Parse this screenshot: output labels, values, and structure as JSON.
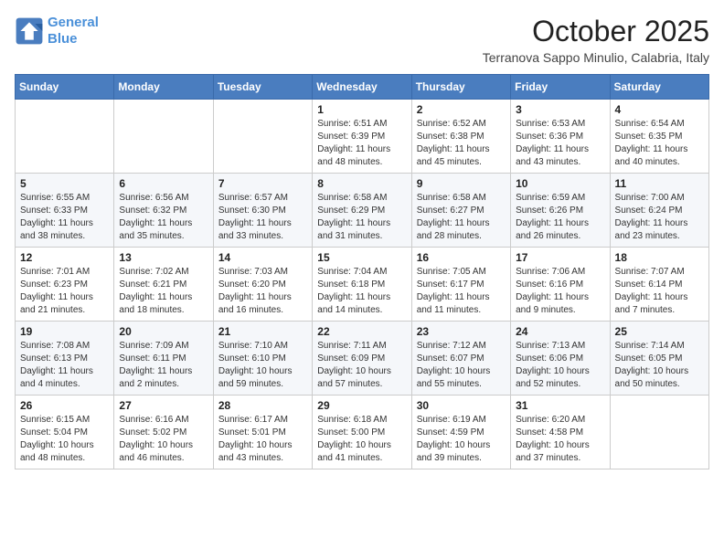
{
  "header": {
    "logo_line1": "General",
    "logo_line2": "Blue",
    "month": "October 2025",
    "location": "Terranova Sappo Minulio, Calabria, Italy"
  },
  "weekdays": [
    "Sunday",
    "Monday",
    "Tuesday",
    "Wednesday",
    "Thursday",
    "Friday",
    "Saturday"
  ],
  "weeks": [
    [
      {
        "day": "",
        "sunrise": "",
        "sunset": "",
        "daylight": ""
      },
      {
        "day": "",
        "sunrise": "",
        "sunset": "",
        "daylight": ""
      },
      {
        "day": "",
        "sunrise": "",
        "sunset": "",
        "daylight": ""
      },
      {
        "day": "1",
        "sunrise": "Sunrise: 6:51 AM",
        "sunset": "Sunset: 6:39 PM",
        "daylight": "Daylight: 11 hours and 48 minutes."
      },
      {
        "day": "2",
        "sunrise": "Sunrise: 6:52 AM",
        "sunset": "Sunset: 6:38 PM",
        "daylight": "Daylight: 11 hours and 45 minutes."
      },
      {
        "day": "3",
        "sunrise": "Sunrise: 6:53 AM",
        "sunset": "Sunset: 6:36 PM",
        "daylight": "Daylight: 11 hours and 43 minutes."
      },
      {
        "day": "4",
        "sunrise": "Sunrise: 6:54 AM",
        "sunset": "Sunset: 6:35 PM",
        "daylight": "Daylight: 11 hours and 40 minutes."
      }
    ],
    [
      {
        "day": "5",
        "sunrise": "Sunrise: 6:55 AM",
        "sunset": "Sunset: 6:33 PM",
        "daylight": "Daylight: 11 hours and 38 minutes."
      },
      {
        "day": "6",
        "sunrise": "Sunrise: 6:56 AM",
        "sunset": "Sunset: 6:32 PM",
        "daylight": "Daylight: 11 hours and 35 minutes."
      },
      {
        "day": "7",
        "sunrise": "Sunrise: 6:57 AM",
        "sunset": "Sunset: 6:30 PM",
        "daylight": "Daylight: 11 hours and 33 minutes."
      },
      {
        "day": "8",
        "sunrise": "Sunrise: 6:58 AM",
        "sunset": "Sunset: 6:29 PM",
        "daylight": "Daylight: 11 hours and 31 minutes."
      },
      {
        "day": "9",
        "sunrise": "Sunrise: 6:58 AM",
        "sunset": "Sunset: 6:27 PM",
        "daylight": "Daylight: 11 hours and 28 minutes."
      },
      {
        "day": "10",
        "sunrise": "Sunrise: 6:59 AM",
        "sunset": "Sunset: 6:26 PM",
        "daylight": "Daylight: 11 hours and 26 minutes."
      },
      {
        "day": "11",
        "sunrise": "Sunrise: 7:00 AM",
        "sunset": "Sunset: 6:24 PM",
        "daylight": "Daylight: 11 hours and 23 minutes."
      }
    ],
    [
      {
        "day": "12",
        "sunrise": "Sunrise: 7:01 AM",
        "sunset": "Sunset: 6:23 PM",
        "daylight": "Daylight: 11 hours and 21 minutes."
      },
      {
        "day": "13",
        "sunrise": "Sunrise: 7:02 AM",
        "sunset": "Sunset: 6:21 PM",
        "daylight": "Daylight: 11 hours and 18 minutes."
      },
      {
        "day": "14",
        "sunrise": "Sunrise: 7:03 AM",
        "sunset": "Sunset: 6:20 PM",
        "daylight": "Daylight: 11 hours and 16 minutes."
      },
      {
        "day": "15",
        "sunrise": "Sunrise: 7:04 AM",
        "sunset": "Sunset: 6:18 PM",
        "daylight": "Daylight: 11 hours and 14 minutes."
      },
      {
        "day": "16",
        "sunrise": "Sunrise: 7:05 AM",
        "sunset": "Sunset: 6:17 PM",
        "daylight": "Daylight: 11 hours and 11 minutes."
      },
      {
        "day": "17",
        "sunrise": "Sunrise: 7:06 AM",
        "sunset": "Sunset: 6:16 PM",
        "daylight": "Daylight: 11 hours and 9 minutes."
      },
      {
        "day": "18",
        "sunrise": "Sunrise: 7:07 AM",
        "sunset": "Sunset: 6:14 PM",
        "daylight": "Daylight: 11 hours and 7 minutes."
      }
    ],
    [
      {
        "day": "19",
        "sunrise": "Sunrise: 7:08 AM",
        "sunset": "Sunset: 6:13 PM",
        "daylight": "Daylight: 11 hours and 4 minutes."
      },
      {
        "day": "20",
        "sunrise": "Sunrise: 7:09 AM",
        "sunset": "Sunset: 6:11 PM",
        "daylight": "Daylight: 11 hours and 2 minutes."
      },
      {
        "day": "21",
        "sunrise": "Sunrise: 7:10 AM",
        "sunset": "Sunset: 6:10 PM",
        "daylight": "Daylight: 10 hours and 59 minutes."
      },
      {
        "day": "22",
        "sunrise": "Sunrise: 7:11 AM",
        "sunset": "Sunset: 6:09 PM",
        "daylight": "Daylight: 10 hours and 57 minutes."
      },
      {
        "day": "23",
        "sunrise": "Sunrise: 7:12 AM",
        "sunset": "Sunset: 6:07 PM",
        "daylight": "Daylight: 10 hours and 55 minutes."
      },
      {
        "day": "24",
        "sunrise": "Sunrise: 7:13 AM",
        "sunset": "Sunset: 6:06 PM",
        "daylight": "Daylight: 10 hours and 52 minutes."
      },
      {
        "day": "25",
        "sunrise": "Sunrise: 7:14 AM",
        "sunset": "Sunset: 6:05 PM",
        "daylight": "Daylight: 10 hours and 50 minutes."
      }
    ],
    [
      {
        "day": "26",
        "sunrise": "Sunrise: 6:15 AM",
        "sunset": "Sunset: 5:04 PM",
        "daylight": "Daylight: 10 hours and 48 minutes."
      },
      {
        "day": "27",
        "sunrise": "Sunrise: 6:16 AM",
        "sunset": "Sunset: 5:02 PM",
        "daylight": "Daylight: 10 hours and 46 minutes."
      },
      {
        "day": "28",
        "sunrise": "Sunrise: 6:17 AM",
        "sunset": "Sunset: 5:01 PM",
        "daylight": "Daylight: 10 hours and 43 minutes."
      },
      {
        "day": "29",
        "sunrise": "Sunrise: 6:18 AM",
        "sunset": "Sunset: 5:00 PM",
        "daylight": "Daylight: 10 hours and 41 minutes."
      },
      {
        "day": "30",
        "sunrise": "Sunrise: 6:19 AM",
        "sunset": "Sunset: 4:59 PM",
        "daylight": "Daylight: 10 hours and 39 minutes."
      },
      {
        "day": "31",
        "sunrise": "Sunrise: 6:20 AM",
        "sunset": "Sunset: 4:58 PM",
        "daylight": "Daylight: 10 hours and 37 minutes."
      },
      {
        "day": "",
        "sunrise": "",
        "sunset": "",
        "daylight": ""
      }
    ]
  ]
}
